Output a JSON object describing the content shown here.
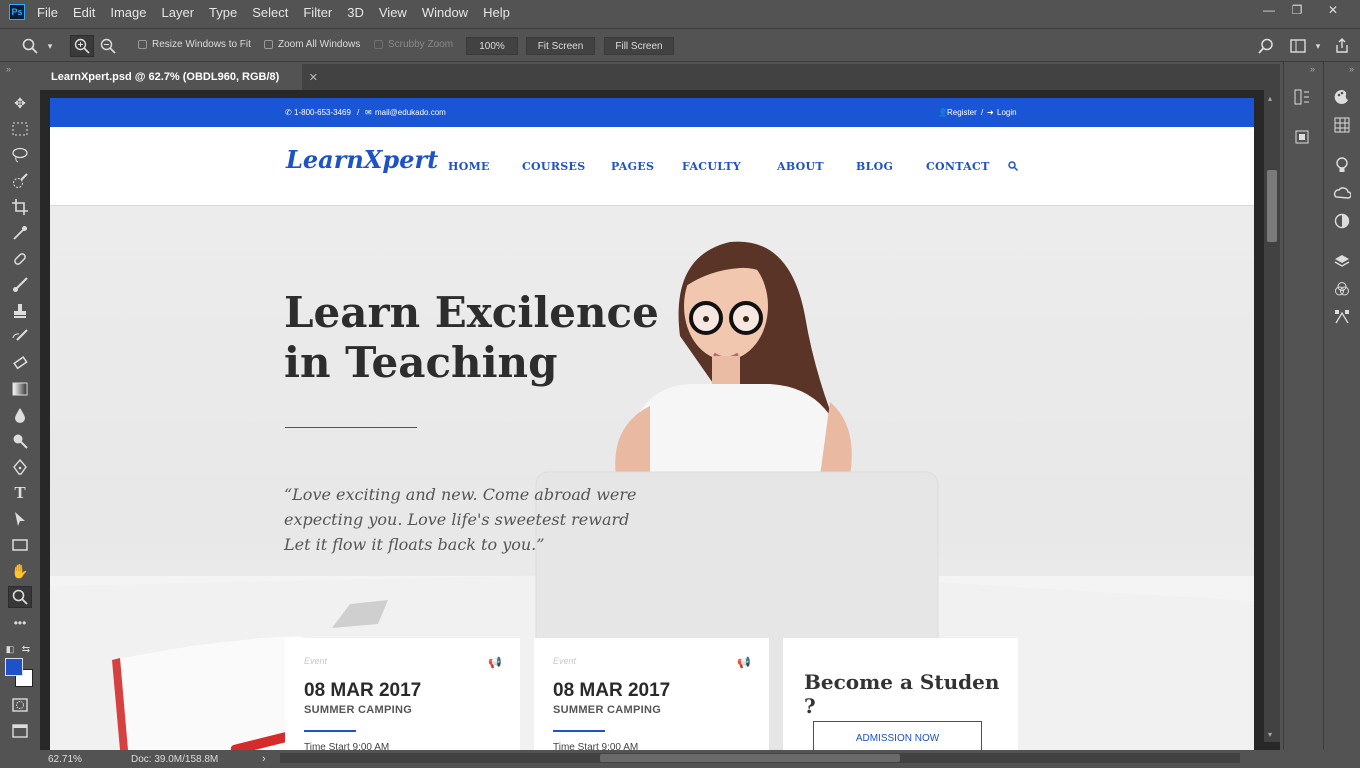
{
  "app": {
    "menu": [
      "File",
      "Edit",
      "Image",
      "Layer",
      "Type",
      "Select",
      "Filter",
      "3D",
      "View",
      "Window",
      "Help"
    ],
    "options": {
      "resize_windows": "Resize Windows to Fit",
      "zoom_all": "Zoom All Windows",
      "scrubby": "Scrubby Zoom",
      "zoom_value": "100%",
      "fit_screen": "Fit Screen",
      "fill_screen": "Fill Screen"
    },
    "doc_tab": "LearnXpert.psd @ 62.7% (OBDL960, RGB/8)",
    "status": {
      "zoom": "62.71%",
      "doc": "Doc: 39.0M/158.8M"
    }
  },
  "site": {
    "topbar": {
      "phone": "1-800-653-3469",
      "email": "mail@edukado.com",
      "register": "Register",
      "login": "Login"
    },
    "logo": "LearnXpert",
    "nav": [
      "HOME",
      "COURSES",
      "PAGES",
      "FACULTY",
      "ABOUT",
      "BLOG",
      "CONTACT"
    ],
    "hero": {
      "title_line1": "Learn Excilence",
      "title_line2": "in Teaching",
      "quote_line1": "“Love exciting and new. Come abroad were",
      "quote_line2": "expecting you. Love life's sweetest reward",
      "quote_line3": "Let it flow it floats back to you.”"
    },
    "cards": [
      {
        "label": "Event",
        "date": "08 MAR 2017",
        "title": "SUMMER CAMPING",
        "time": "Time Start 9:00 AM"
      },
      {
        "label": "Event",
        "date": "08 MAR 2017",
        "title": "SUMMER CAMPING",
        "time": "Time Start 9:00 AM"
      }
    ],
    "cta": {
      "title": "Become a Studen ?",
      "button": "ADMISSION NOW"
    }
  },
  "colors": {
    "accent": "#1d52c9",
    "ps_bg": "#535353"
  }
}
